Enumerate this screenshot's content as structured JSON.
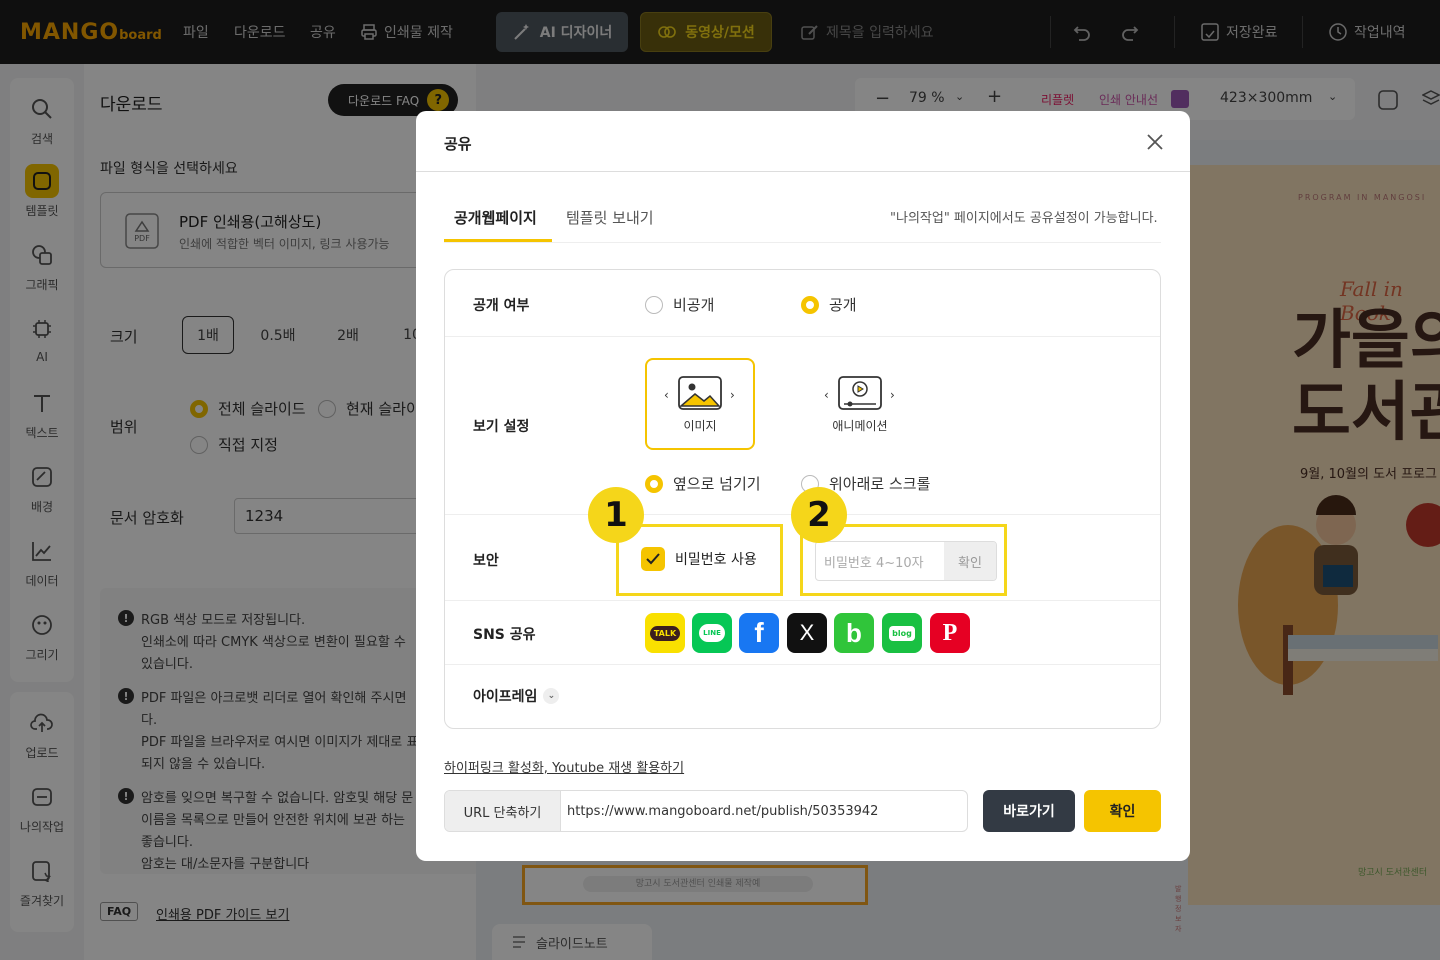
{
  "app": {
    "logo_main": "MANGO",
    "logo_sub": "board",
    "menu": [
      "파일",
      "다운로드",
      "공유"
    ],
    "print_label": "인쇄물 제작",
    "ai_designer": "AI 디자이너",
    "video_motion": "동영상/모션",
    "title_placeholder": "제목을 입력하세요",
    "save_status": "저장완료",
    "history": "작업내역",
    "accent": "#f5c400"
  },
  "rail": {
    "items": [
      "검색",
      "템플릿",
      "그래픽",
      "AI",
      "텍스트",
      "배경",
      "데이터",
      "그리기"
    ],
    "items2": [
      "업로드",
      "나의작업",
      "즐겨찾기"
    ]
  },
  "panel": {
    "title": "다운로드",
    "faq_pill": "다운로드 FAQ",
    "faq_q": "?",
    "choose_format": "파일 형식을 선택하세요",
    "pdf_title": "PDF 인쇄용(고해상도)",
    "pdf_desc": "인쇄에 적합한 벡터 이미지, 링크 사용가능",
    "pdf_icon_text": "PDF",
    "size_label": "크기",
    "sizes": [
      "1배",
      "0.5배",
      "2배",
      "10"
    ],
    "range_label": "범위",
    "range_all": "전체 슬라이드",
    "range_current": "현재 슬라이드",
    "range_custom": "직접 지정",
    "encrypt_label": "문서 암호화",
    "encrypt_value": "1234",
    "notices": [
      "RGB 색상 모드로 저장됩니다.",
      "인쇄소에 따라 CMYK 색상으로 변환이 필요할 수",
      "있습니다.",
      "PDF 파일은 아크로뱃 리더로 열어 확인해 주시면",
      "다.",
      "PDF 파일을 브라우저로 여시면 이미지가 제대로 표",
      "되지 않을 수 있습니다.",
      "암호를 잊으면 복구할 수 없습니다. 암호및 해당 문",
      "이름을 목록으로 만들어 안전한 위치에 보관 하는",
      "좋습니다.",
      "암호는 대/소문자를 구분합니다"
    ],
    "faq_tag": "FAQ",
    "faq_link": "인쇄용 PDF 가이드 보기"
  },
  "canvas": {
    "zoom": "79 %",
    "bleed": "리플렛",
    "print_guide": "인쇄 안내선",
    "page_size": "423×300mm",
    "poster_top": "PROGRAM IN MANGOSI",
    "poster_script": "Fall in Book",
    "poster_title1": "가을의",
    "poster_title2": "도서관",
    "poster_sub": "9월, 10월의 도서 프로그",
    "poster_foot": "망고시 도서관센터",
    "poster_foot2": "발행정보자",
    "slide_note": "슬라이드노트",
    "slide_caption": "망고시 도서관센터 인쇄물 제작예"
  },
  "dialog": {
    "title": "공유",
    "tab_web": "공개웹페이지",
    "tab_send": "템플릿 보내기",
    "note": "\"나의작업\" 페이지에서도 공유설정이 가능합니다.",
    "public_label": "공개 여부",
    "private": "비공개",
    "public": "공개",
    "view_label": "보기 설정",
    "view_image": "이미지",
    "view_anim": "애니메이션",
    "flip_side": "옆으로 넘기기",
    "scroll_vert": "위아래로 스크롤",
    "security_label": "보안",
    "use_password": "비밀번호 사용",
    "pw_placeholder": "비밀번호 4~10자",
    "pw_confirm": "확인",
    "sns_label": "SNS 공유",
    "sns": [
      {
        "name": "kakaotalk",
        "text": "TALK",
        "color": "#f9e000"
      },
      {
        "name": "line",
        "text": "LINE",
        "color": "#06c755"
      },
      {
        "name": "facebook",
        "text": "f",
        "color": "#1877f2"
      },
      {
        "name": "x",
        "text": "X",
        "color": "#111111"
      },
      {
        "name": "band",
        "text": "b",
        "color": "#30c53a"
      },
      {
        "name": "blog",
        "text": "blog",
        "color": "#19c042"
      },
      {
        "name": "pinterest",
        "text": "P",
        "color": "#e60023"
      }
    ],
    "iframe": "아이프레임",
    "hyperlink": "하이퍼링크 활성화, Youtube 재생 활용하기",
    "url_head": "URL 단축하기",
    "url_value": "https://www.mangoboard.net/publish/50353942",
    "goto": "바로가기",
    "ok": "확인",
    "badge1": "1",
    "badge2": "2"
  }
}
